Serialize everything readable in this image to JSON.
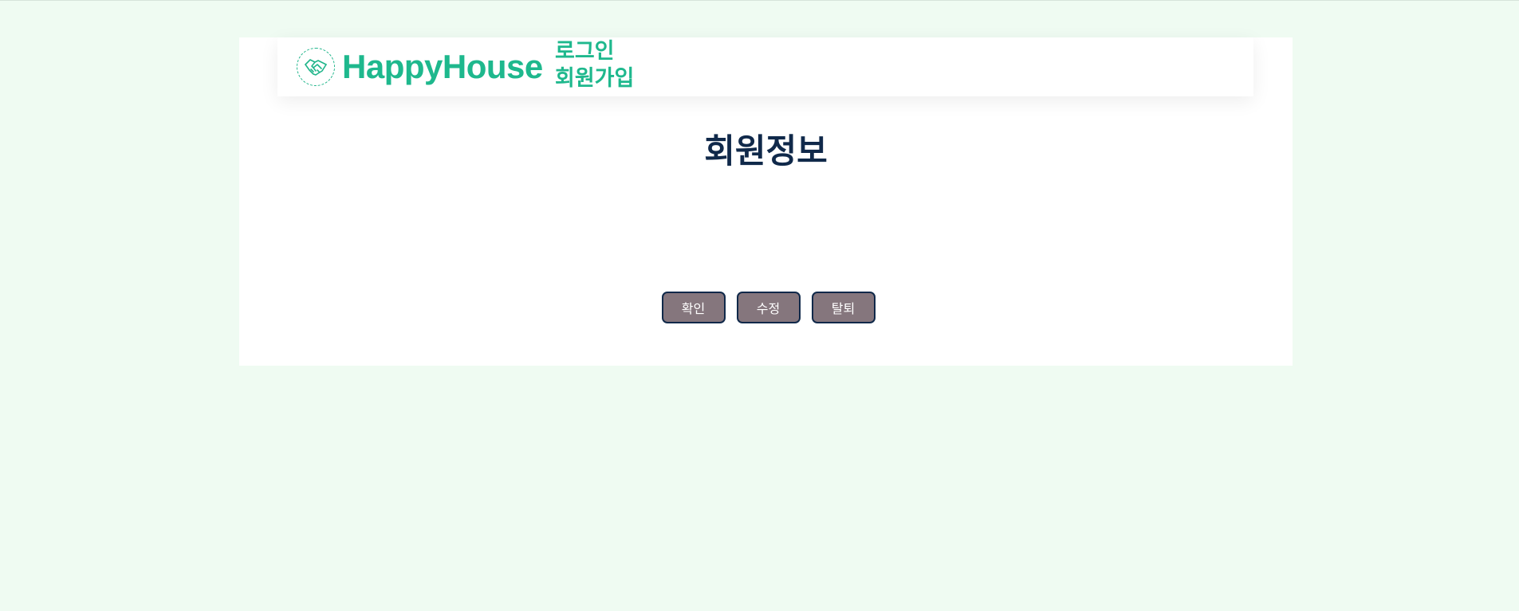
{
  "header": {
    "brand_name": "HappyHouse",
    "logo_icon": "handshake-icon",
    "nav_links": [
      {
        "label": "로그인"
      },
      {
        "label": "회원가입"
      }
    ]
  },
  "main": {
    "title": "회원정보",
    "buttons": [
      {
        "label": "확인"
      },
      {
        "label": "수정"
      },
      {
        "label": "탈퇴"
      }
    ]
  },
  "colors": {
    "background": "#effbf2",
    "brand": "#1eb88d",
    "title": "#10294a",
    "button_fill": "#85767d",
    "button_border": "#10294a"
  }
}
